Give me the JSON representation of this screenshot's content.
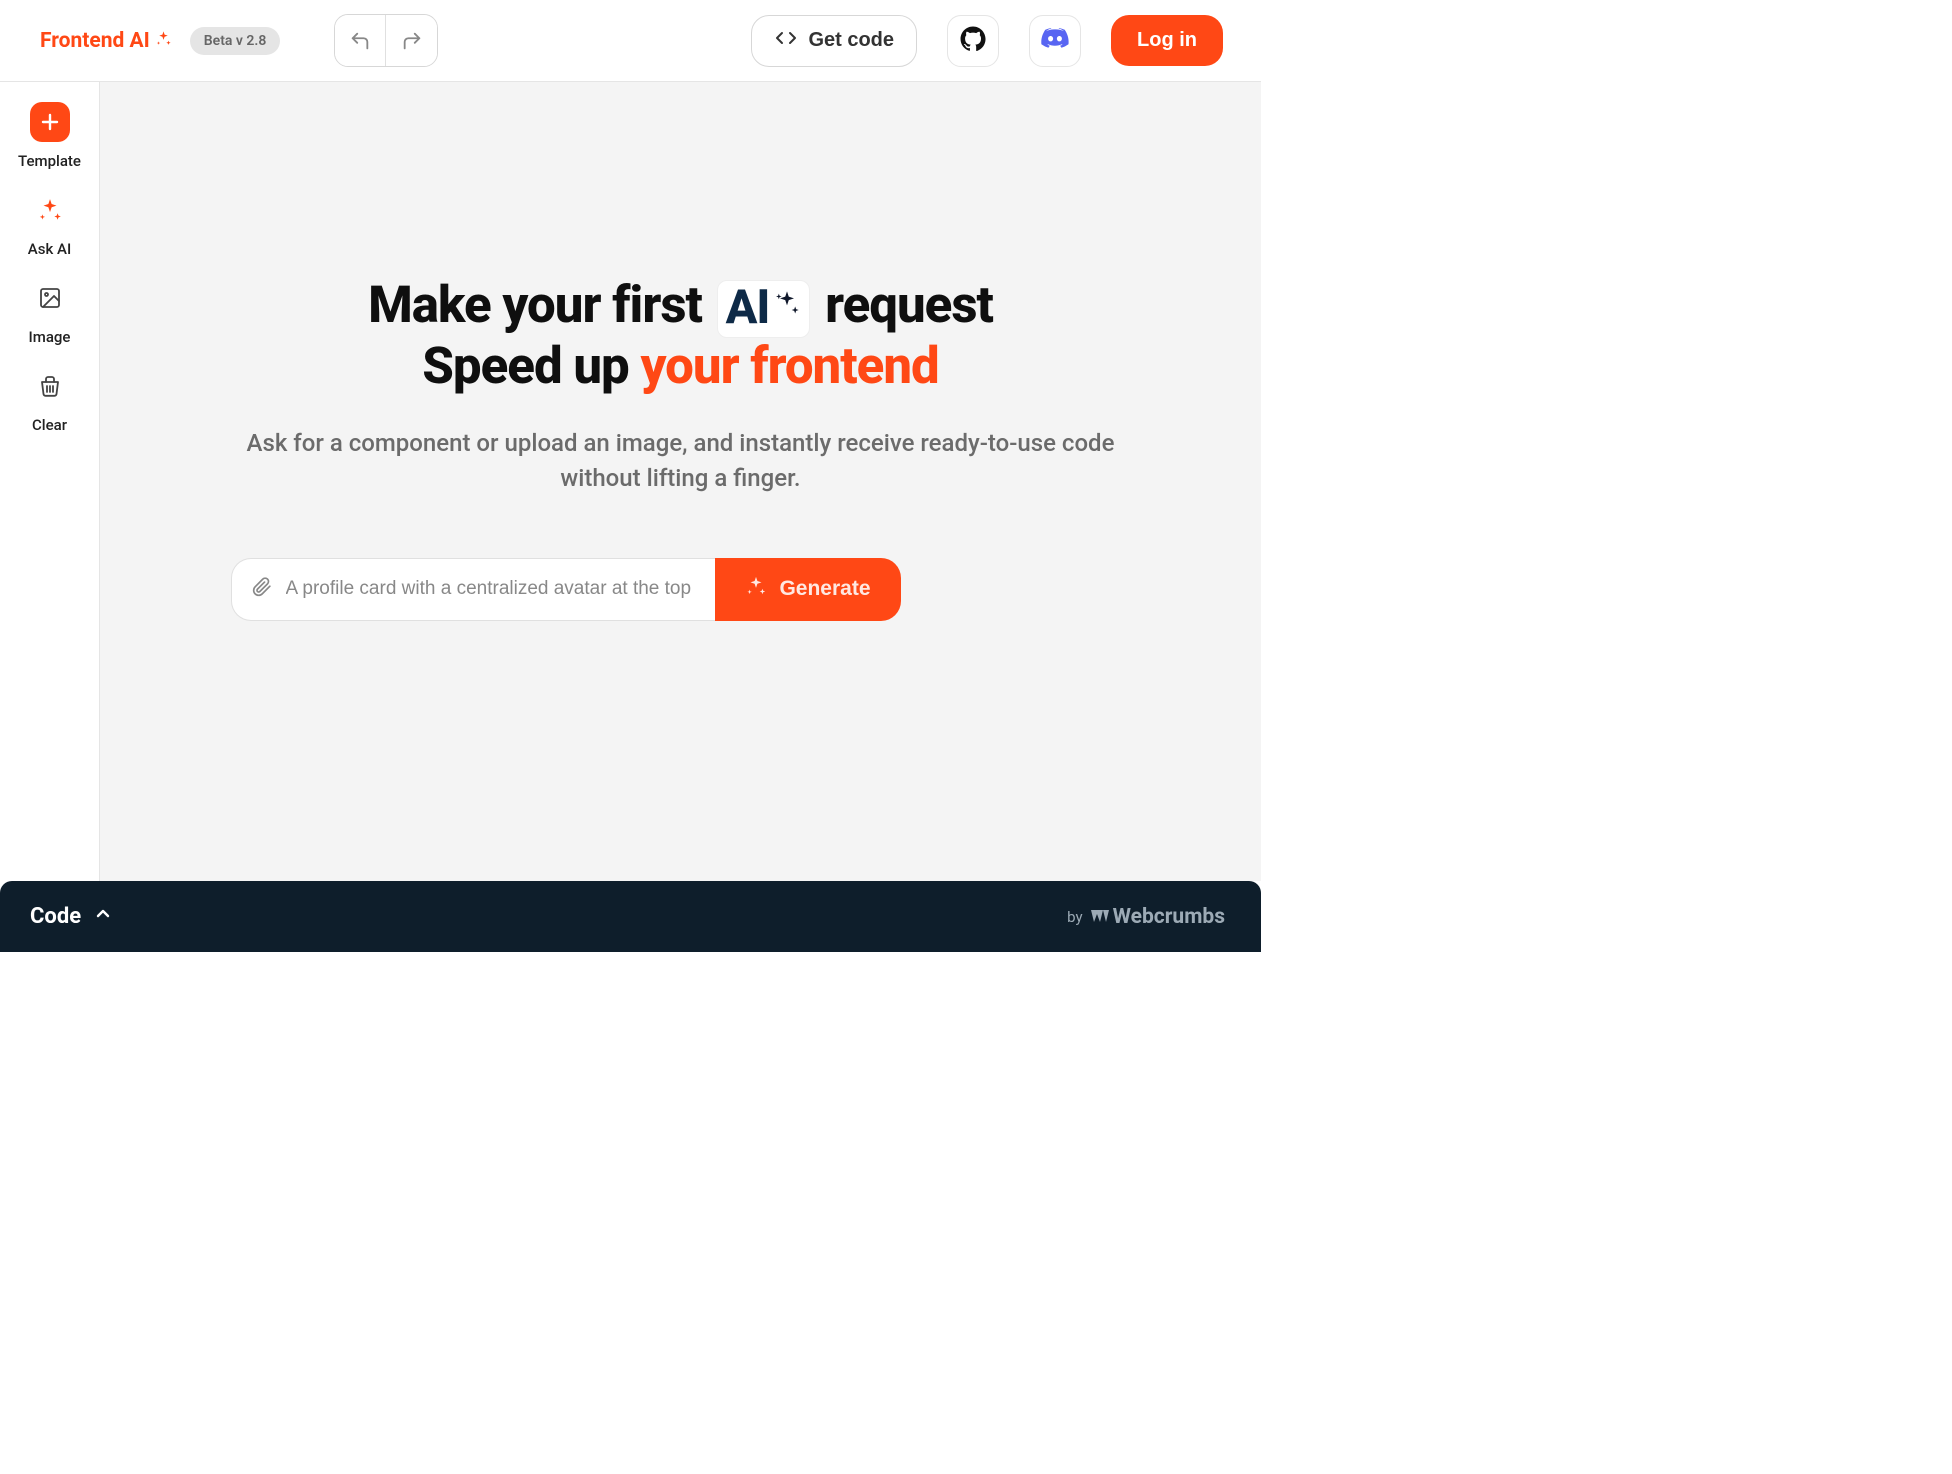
{
  "header": {
    "logo_text": "Frontend AI",
    "beta_label": "Beta v 2.8",
    "get_code_label": "Get code",
    "login_label": "Log in"
  },
  "sidebar": {
    "items": [
      {
        "label": "Template"
      },
      {
        "label": "Ask AI"
      },
      {
        "label": "Image"
      },
      {
        "label": "Clear"
      }
    ]
  },
  "hero": {
    "title_line1_pre": "Make your first ",
    "title_line1_chip": "AI",
    "title_line1_post": " request",
    "title_line2_pre": "Speed up ",
    "title_line2_accent": "your frontend",
    "subtitle": "Ask for a component or upload an image, and instantly receive ready-to-use code without lifting a finger.",
    "prompt_placeholder": "A profile card with a centralized avatar at the top",
    "generate_label": "Generate"
  },
  "footer": {
    "code_label": "Code",
    "by_prefix": "by",
    "brand": "Webcrumbs"
  }
}
